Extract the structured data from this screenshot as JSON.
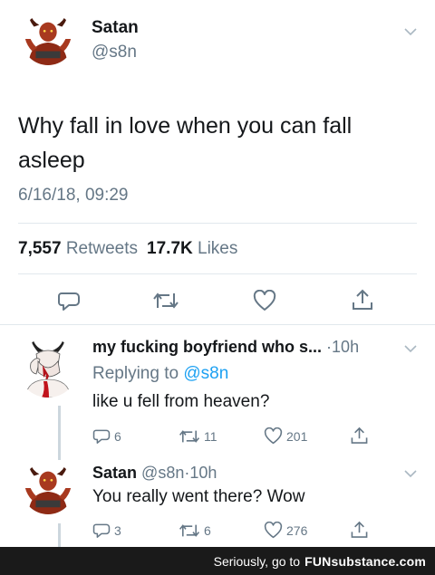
{
  "main_tweet": {
    "author_name": "Satan",
    "author_handle": "@s8n",
    "text": "Why fall in love when you can fall asleep",
    "timestamp": "6/16/18, 09:29",
    "retweet_count": "7,557",
    "retweet_label": "Retweets",
    "like_count": "17.7K",
    "like_label": "Likes"
  },
  "replies": [
    {
      "author_name": "my fucking boyfriend who s...",
      "separator": "·",
      "time": "10h",
      "replying_label": "Replying to",
      "replying_to": "@s8n",
      "text": "like u fell from heaven?",
      "reply_count": "6",
      "retweet_count": "11",
      "like_count": "201"
    },
    {
      "author_name": "Satan",
      "author_handle": "@s8n",
      "separator": "·",
      "time": "10h",
      "text": "You really went there? Wow",
      "reply_count": "3",
      "retweet_count": "6",
      "like_count": "276"
    }
  ],
  "footer": {
    "text": "Seriously, go to",
    "brand": "FUNsubstance.com"
  },
  "colors": {
    "primary_text": "#14171a",
    "secondary_text": "#657786",
    "mention": "#1da1f2",
    "divider": "#e1e8ed",
    "footer_bg": "#1a1a1a"
  },
  "icons": [
    "reply-icon",
    "retweet-icon",
    "like-icon",
    "share-icon",
    "chevron-down-icon"
  ]
}
